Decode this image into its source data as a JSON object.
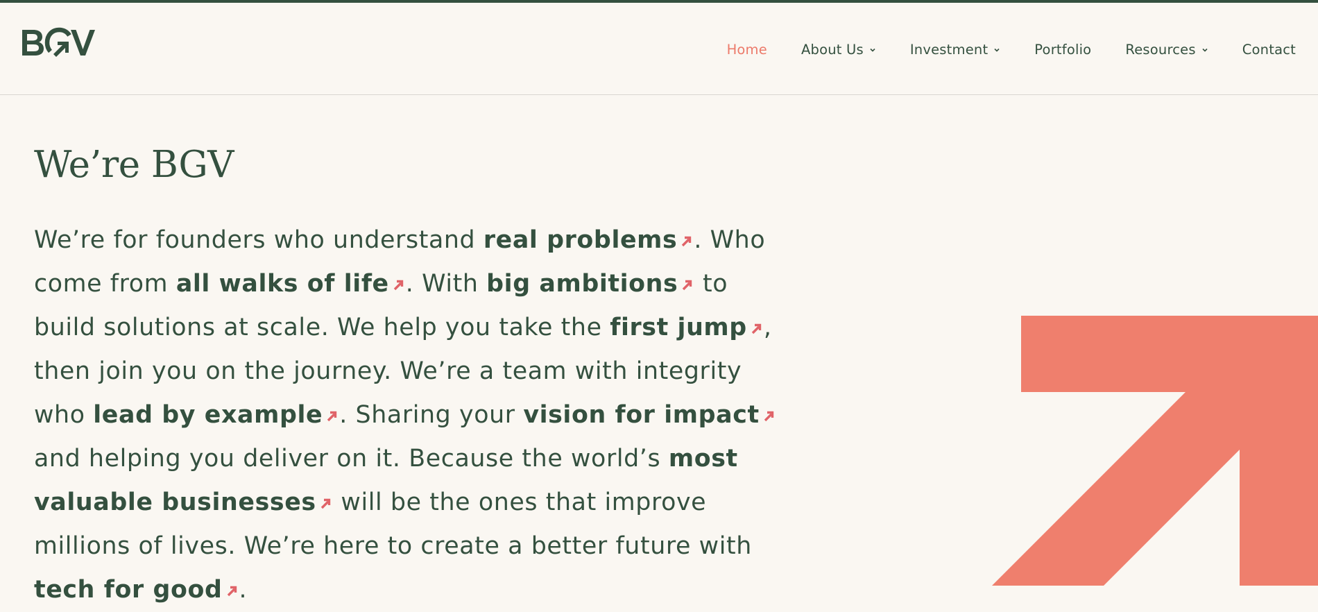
{
  "brand": {
    "logo_text": "BGV",
    "primary_color": "#34503f",
    "accent_color": "#ec7a6a",
    "background_color": "#faf7f2"
  },
  "nav": {
    "items": [
      {
        "label": "Home",
        "active": true,
        "has_dropdown": false
      },
      {
        "label": "About Us",
        "active": false,
        "has_dropdown": true
      },
      {
        "label": "Investment",
        "active": false,
        "has_dropdown": true
      },
      {
        "label": "Portfolio",
        "active": false,
        "has_dropdown": false
      },
      {
        "label": "Resources",
        "active": false,
        "has_dropdown": true
      },
      {
        "label": "Contact",
        "active": false,
        "has_dropdown": false
      }
    ]
  },
  "hero": {
    "title": "We’re BGV",
    "t1": "We’re for founders who understand ",
    "l1": "real problems",
    "t2": ". Who come from ",
    "l2": "all walks of life",
    "t3": ". With ",
    "l3": "big ambitions",
    "t4": " to build solutions at scale. We help you take the ",
    "l4": "first jump",
    "t5": ", then join you on the journey. We’re a team with integrity who ",
    "l5": "lead by example",
    "t6": ". Sharing your ",
    "l6": "vision for impact",
    "t7": " and helping you deliver on it. Because the world’s ",
    "l7": "most valuable businesses",
    "t8": " will be the ones that improve millions of lives. We’re here to create a better future with ",
    "l8": "tech for good",
    "t9": "."
  },
  "icons": {
    "link_arrow": "arrow-up-right-icon",
    "dropdown": "chevron-down-icon",
    "hero_graphic": "large-arrow-up-right-icon"
  }
}
